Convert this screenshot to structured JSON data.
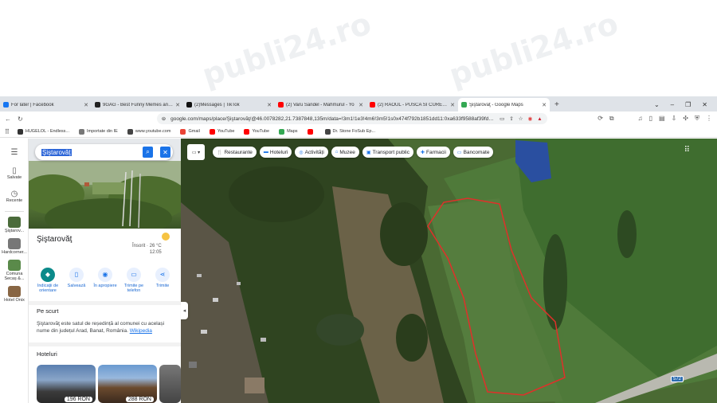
{
  "browser": {
    "tabs": [
      {
        "title": "For later | Facebook",
        "color": "#1877f2"
      },
      {
        "title": "9GAG - Best Funny Memes and Brea",
        "color": "#222222"
      },
      {
        "title": "(2)Messages | TikTok",
        "color": "#111111"
      },
      {
        "title": "(2) Varu Sandel - Mahmurul - Yo",
        "color": "#ff0000"
      },
      {
        "title": "(2) RAOUL - PUSCA SI CUREAUA LAT",
        "color": "#ff0000"
      },
      {
        "title": "Şiştarovăţ - Google Maps",
        "color": "#34a853"
      }
    ],
    "url": "google.com/maps/place/Şiştarovăţ/@46.0078282,21.7387848,135m/data=!3m1!1e3!4m6!3m5!1s0x474f792b1851dd11:0xa633f9588af39fde!8m...",
    "bookmarks": [
      {
        "label": "HUGELOL - Endless...",
        "color": "#333333"
      },
      {
        "label": "Importate din IE",
        "color": "#777777"
      },
      {
        "label": "www.youtube.com",
        "color": "#444444"
      },
      {
        "label": "Gmail",
        "color": "#ea4335"
      },
      {
        "label": "YouTube",
        "color": "#ff0000"
      },
      {
        "label": "YouTube",
        "color": "#ff0000"
      },
      {
        "label": "Maps",
        "color": "#34a853"
      },
      {
        "label": "",
        "color": "#ff0000"
      },
      {
        "label": "Dr. Stone FoSub Ep...",
        "color": "#444444"
      }
    ]
  },
  "rail": {
    "saved": "Salvate",
    "recent": "Recente",
    "recent_places": [
      {
        "label": "Şiştarov...",
        "color": "#4a6b3a"
      },
      {
        "label": "Hardcorner...",
        "color": "#777777"
      },
      {
        "label": "Comuna Secaș &...",
        "color": "#5a8a4a"
      },
      {
        "label": "Hotel Onix",
        "color": "#886644"
      }
    ]
  },
  "place": {
    "search_query": "Şiştarovăţ",
    "name": "Şiştarovăţ",
    "weather_condition": "Însorit · 26 °C",
    "weather_time": "12:05",
    "actions": [
      {
        "label": "Indicații de orientare",
        "icon": "directions-icon"
      },
      {
        "label": "Salvează",
        "icon": "bookmark-icon"
      },
      {
        "label": "În apropiere",
        "icon": "nearby-icon"
      },
      {
        "label": "Trimite pe telefon",
        "icon": "phone-icon"
      },
      {
        "label": "Trimite",
        "icon": "share-icon"
      }
    ],
    "summary_heading": "Pe scurt",
    "summary_text": "Şiştarovăţ este satul de reședință al comunei cu același nume din județul Arad, Banat, România.",
    "summary_link": "Wikipedia",
    "hotels_heading": "Hoteluri",
    "hotels": [
      {
        "price": "196 RON"
      },
      {
        "price": "288 RON"
      }
    ]
  },
  "map": {
    "chips": [
      {
        "label": "Restaurante",
        "icon": "restaurant-icon"
      },
      {
        "label": "Hoteluri",
        "icon": "hotel-icon"
      },
      {
        "label": "Activități",
        "icon": "camera-icon"
      },
      {
        "label": "Muzee",
        "icon": "museum-icon"
      },
      {
        "label": "Transport public",
        "icon": "transit-icon"
      },
      {
        "label": "Farmacii",
        "icon": "pharmacy-icon"
      },
      {
        "label": "Bancomate",
        "icon": "atm-icon"
      }
    ],
    "road_label": "572",
    "outline_color": "#e0302a"
  }
}
